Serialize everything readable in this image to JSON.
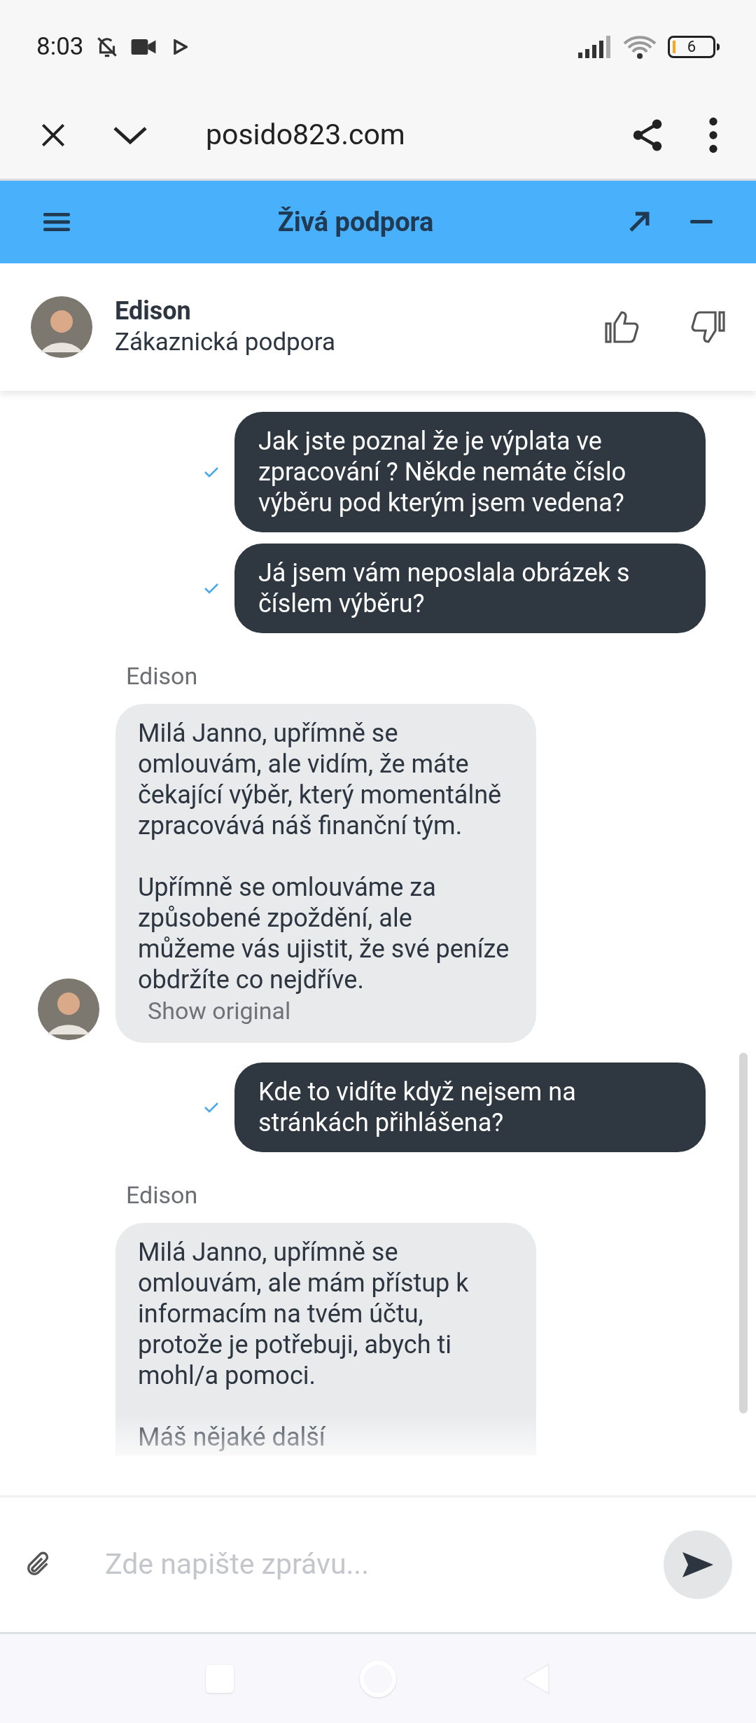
{
  "status_bar": {
    "time": "8:03",
    "battery": "6"
  },
  "browser": {
    "url": "posido823.com"
  },
  "chat_header": {
    "title": "Živá podpora"
  },
  "agent": {
    "name": "Edison",
    "role": "Zákaznická podpora"
  },
  "messages": [
    {
      "kind": "outgoing",
      "delivered": true,
      "text": "Jak jste poznal že je výplata ve zpracování ? Někde nemáte číslo výběru pod kterým jsem vedena?"
    },
    {
      "kind": "outgoing",
      "delivered": true,
      "text": "Já jsem vám neposlala obrázek s číslem výběru?"
    },
    {
      "kind": "incoming",
      "sender": "Edison",
      "avatar": true,
      "cut": false,
      "paragraphs": [
        "Milá Janno, upřímně se omlouvám, ale vidím, že máte čekající výběr, který momentálně zpracovává náš finanční tým.",
        "Upřímně se omlouváme za způsobené zpoždění, ale můžeme vás ujistit, že své peníze obdržíte co nejdříve."
      ],
      "link": "Show original"
    },
    {
      "kind": "outgoing",
      "delivered": true,
      "text": "Kde to vidíte když nejsem na stránkách přihlášena?"
    },
    {
      "kind": "incoming",
      "sender": "Edison",
      "avatar": false,
      "cut": true,
      "paragraphs": [
        "Milá Janno, upřímně se omlouvám, ale mám přístup k informacím na tvém účtu, protože je potřebuji, abych ti mohl/a pomoci.",
        "Máš nějaké další"
      ]
    }
  ],
  "composer": {
    "placeholder": "Zde napište zprávu..."
  }
}
